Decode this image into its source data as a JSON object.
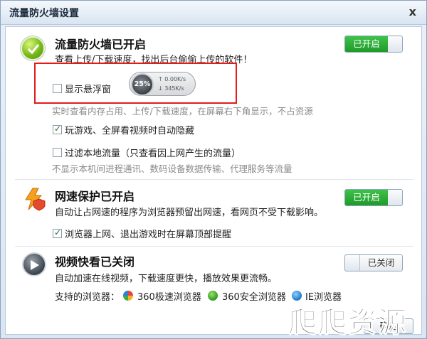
{
  "window": {
    "title": "流量防火墙设置",
    "close_label": "x"
  },
  "firewall": {
    "title": "流量防火墙已开启",
    "desc": "查看上传/下载速度，找出后台偷偷上传的软件！",
    "toggle_label": "已开启",
    "float": {
      "checkbox_label": "显示悬浮窗",
      "checked": false,
      "gauge": "25%",
      "upload": "↑ 0.00K/s",
      "download": "↓ 345K/s",
      "desc": "实时查看内存占用、上传/下载速度，在屏幕右下角显示，不占资源"
    },
    "autohide": {
      "label": "玩游戏、全屏看视频时自动隐藏",
      "checked": true
    },
    "filter_local": {
      "label": "过滤本地流量（只查看因上网产生的流量）",
      "checked": false,
      "desc": "不显示本机间进程通讯、数码设备数据传输、代理服务等流量"
    }
  },
  "speed": {
    "title": "网速保护已开启",
    "desc": "自动让占网速的程序为浏览器预留出网速，看网页不受下载影响。",
    "toggle_label": "已开启",
    "notify": {
      "label": "浏览器上网、退出游戏时在屏幕顶部提醒",
      "checked": true
    }
  },
  "video": {
    "title": "视频快看已关闭",
    "desc": "自动加速在线视频，下载速度更快，播放效果更流畅。",
    "toggle_label": "已关闭",
    "browsers_label": "支持的浏览器：",
    "browsers": [
      "360极速浏览器",
      "360安全浏览器",
      "IE浏览器"
    ]
  },
  "footer": {
    "ok_label": "确定",
    "watermark": "爬爬资源"
  },
  "colors": {
    "accent_green": "#1f9a2a",
    "highlight_red": "#e21b1b"
  }
}
